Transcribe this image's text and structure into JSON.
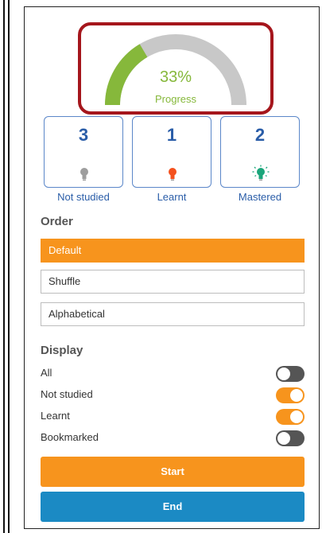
{
  "progress": {
    "percent_text": "33%",
    "label": "Progress",
    "fraction": 0.33,
    "colors": {
      "filled": "#86b83b",
      "track": "#c8c8c8",
      "highlight": "#a5161c"
    }
  },
  "stats": [
    {
      "count": "3",
      "label": "Not studied",
      "icon": "bulb-gray-icon",
      "color": "#9e9e9e"
    },
    {
      "count": "1",
      "label": "Learnt",
      "icon": "bulb-red-icon",
      "color": "#f4511e"
    },
    {
      "count": "2",
      "label": "Mastered",
      "icon": "bulb-green-glow-icon",
      "color": "#1aa57a"
    }
  ],
  "order": {
    "title": "Order",
    "options": [
      "Default",
      "Shuffle",
      "Alphabetical"
    ],
    "selected": "Default"
  },
  "display": {
    "title": "Display",
    "items": [
      {
        "label": "All",
        "on": false
      },
      {
        "label": "Not studied",
        "on": true
      },
      {
        "label": "Learnt",
        "on": true
      },
      {
        "label": "Bookmarked",
        "on": false
      }
    ]
  },
  "buttons": {
    "start": "Start",
    "end": "End"
  },
  "colors": {
    "accent": "#f7941d",
    "end_button": "#1b8ac4",
    "stat_text": "#2a5da8"
  }
}
